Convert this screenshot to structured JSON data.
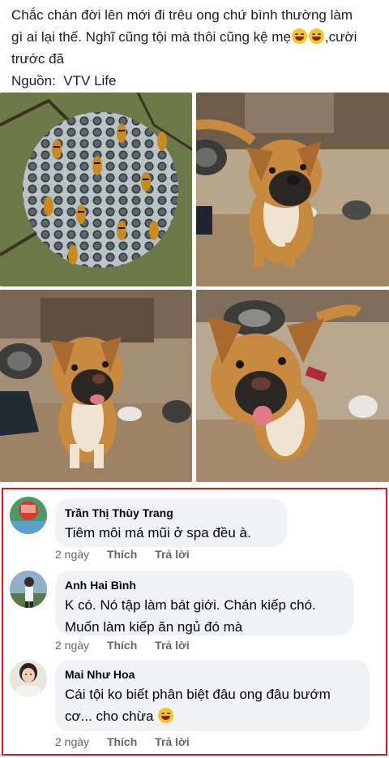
{
  "post": {
    "line1": "Chắc chán đời lên mới đi trêu ong chứ bình thường làm",
    "line2a": "gì ai lại thế. Nghĩ cũng tội mà thôi cũng kệ mẹ",
    "line2b": ",cười",
    "line3": "trước đã",
    "source_label": "Nguồn:",
    "source_name": "VTV Life"
  },
  "comments": [
    {
      "author": "Trần Thị Thùy Trang",
      "text": "Tiêm môi má mũi ở spa đều à.",
      "time": "2 ngày",
      "like": "Thích",
      "reply": "Trả lời"
    },
    {
      "author": "Anh Hai Bình",
      "text_line1": "K có. Nó tập làm bát giới. Chán kiếp chó.",
      "text_line2": "Muốn làm kiếp ăn ngủ đó mà",
      "time": "2 ngày",
      "like": "Thích",
      "reply": "Trả lời"
    },
    {
      "author": "Mai Như Hoa",
      "text_line1": "Cái tội ko biết phân biệt đâu ong đâu bướm",
      "text_line2": "cơ... cho chừa",
      "time": "2 ngày",
      "like": "Thích",
      "reply": "Trả lời"
    }
  ],
  "colors": {
    "highlight_border": "#e3141d",
    "bubble_bg": "#f0f2f5",
    "meta_text": "#65676b"
  }
}
